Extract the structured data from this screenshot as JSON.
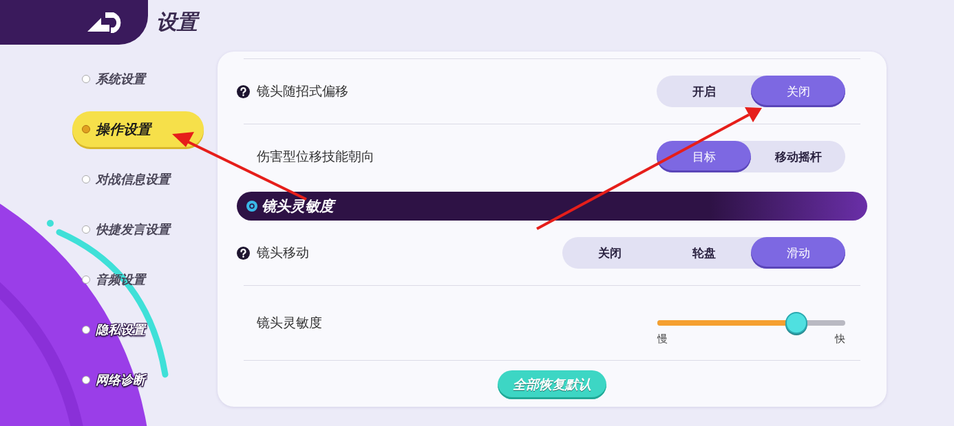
{
  "header": {
    "title": "设置"
  },
  "nav": [
    {
      "label": "系统设置",
      "selected": false
    },
    {
      "label": "操作设置",
      "selected": true
    },
    {
      "label": "对战信息设置",
      "selected": false
    },
    {
      "label": "快捷发言设置",
      "selected": false
    },
    {
      "label": "音频设置",
      "selected": false
    },
    {
      "label": "隐私设置",
      "selected": false
    },
    {
      "label": "网络诊断",
      "selected": false
    }
  ],
  "settings": [
    {
      "kind": "toggle",
      "label": "镜头随招式偏移",
      "help": true,
      "options": [
        {
          "label": "开启",
          "selected": false
        },
        {
          "label": "关闭",
          "selected": true
        }
      ]
    },
    {
      "kind": "toggle",
      "label": "伤害型位移技能朝向",
      "help": false,
      "options": [
        {
          "label": "目标",
          "selected": true
        },
        {
          "label": "移动摇杆",
          "selected": false
        }
      ]
    },
    {
      "kind": "section",
      "label": "镜头灵敏度"
    },
    {
      "kind": "toggle",
      "label": "镜头移动",
      "help": true,
      "options": [
        {
          "label": "关闭",
          "selected": false
        },
        {
          "label": "轮盘",
          "selected": false
        },
        {
          "label": "滑动",
          "selected": true
        }
      ]
    },
    {
      "kind": "slider",
      "label": "镜头灵敏度",
      "level": 0.74,
      "min_label": "慢",
      "max_label": "快"
    }
  ],
  "reset_button": "全部恢复默认"
}
